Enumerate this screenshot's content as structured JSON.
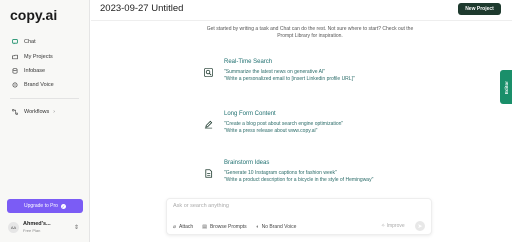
{
  "sidebar": {
    "logo": "copy.ai",
    "items": [
      {
        "label": "Chat",
        "icon": "chat-icon"
      },
      {
        "label": "My Projects",
        "icon": "folder-icon"
      },
      {
        "label": "Infobase",
        "icon": "database-icon"
      },
      {
        "label": "Brand Voice",
        "icon": "brand-voice-icon"
      }
    ],
    "workflows": {
      "label": "Workflows",
      "icon": "workflow-icon"
    },
    "upgrade_label": "Upgrade to Pro",
    "user": {
      "initials": "AA",
      "name": "Ahmed's...",
      "plan": "Free Plan"
    }
  },
  "header": {
    "title": "2023-09-27 Untitled",
    "new_project_label": "New Project"
  },
  "intro": "Get started by writing a task and Chat can do the rest. Not sure where to start? Check out the Prompt Library for inspiration.",
  "cards": [
    {
      "title": "Real-Time Search",
      "icon": "search-icon",
      "lines": [
        "\"Summarize the latest news on generative AI\"",
        "\"Write a personalized email to [insert Linkedin profile URL]\""
      ]
    },
    {
      "title": "Long Form Content",
      "icon": "pen-icon",
      "lines": [
        "\"Create a blog post about search engine optimization\"",
        "\"Write a press release about www.copy.ai\""
      ]
    },
    {
      "title": "Brainstorm Ideas",
      "icon": "document-icon",
      "lines": [
        "\"Generate 10 Instagram captions for fashion week\"",
        "\"Write a product description for a bicycle in the style of Hemingway\""
      ]
    }
  ],
  "chat": {
    "placeholder": "Ask or search anything",
    "tools": [
      {
        "label": "Attach",
        "icon": "paperclip-icon"
      },
      {
        "label": "Browse Prompts",
        "icon": "book-icon"
      },
      {
        "label": "No Brand Voice",
        "icon": "mic-icon"
      }
    ],
    "improve_label": "Improve",
    "send_icon": "send-icon"
  },
  "editor_tab_label": "Editor",
  "colors": {
    "accent_purple": "#7b5cf5",
    "dark_green": "#1e3a2e",
    "teal_text": "#1e6f6f",
    "editor_green": "#1a8f6a"
  }
}
